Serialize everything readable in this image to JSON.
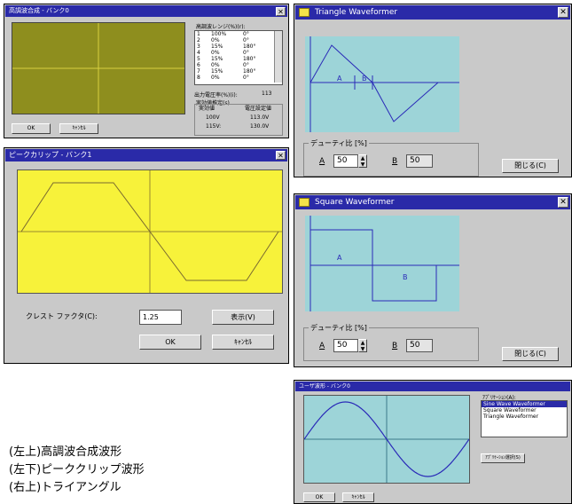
{
  "harmonic": {
    "title": "高調波合成 - バンク0",
    "table_title": "高調波レンジ(%)(r):",
    "rows": [
      {
        "n": "1",
        "pct": "100%",
        "deg": "0°"
      },
      {
        "n": "2",
        "pct": "0%",
        "deg": "0°"
      },
      {
        "n": "3",
        "pct": "15%",
        "deg": "180°"
      },
      {
        "n": "4",
        "pct": "0%",
        "deg": "0°"
      },
      {
        "n": "5",
        "pct": "15%",
        "deg": "180°"
      },
      {
        "n": "6",
        "pct": "0%",
        "deg": "0°"
      },
      {
        "n": "7",
        "pct": "15%",
        "deg": "180°"
      },
      {
        "n": "8",
        "pct": "0%",
        "deg": "0°"
      }
    ],
    "output_label": "出力電圧率(%)(i):",
    "output_value": "113",
    "info_label": "実効値推定(s)",
    "col_actual": "実効値",
    "col_volt": "電圧設定値",
    "actual_1": "100V",
    "volt_1": "113.0V",
    "actual_2": "115V:",
    "volt_2": "130.0V",
    "ok": "OK",
    "cancel": "ｷｬﾝｾﾙ"
  },
  "peak": {
    "title": "ピークカリップ - バンク1",
    "crest_label": "クレスト ファクタ(C):",
    "crest_value": "1.25",
    "display_button": "表示(V)",
    "ok": "OK",
    "cancel": "ｷｬﾝｾﾙ"
  },
  "triangle": {
    "title": "Triangle Waveformer",
    "duty_label": "デューティ比 [%]",
    "a_label": "A",
    "a_value": "50",
    "b_label": "B",
    "b_value": "50",
    "marker_a": "A",
    "marker_b": "B",
    "close_button": "閉じる(C)"
  },
  "square": {
    "title": "Square Waveformer",
    "duty_label": "デューティ比 [%]",
    "a_label": "A",
    "a_value": "50",
    "b_label": "B",
    "b_value": "50",
    "marker_a": "A",
    "marker_b": "B",
    "close_button": "閉じる(C)"
  },
  "memory": {
    "title": "ユーザ波形 - バンク0",
    "list_label": "ｱﾌﾟﾘｹｰｼｮﾝ(A):",
    "items": [
      "Sine Wave Waveformer",
      "Square Waveformer",
      "Triangle Waveformer"
    ],
    "select_button": "ｱﾌﾟﾘｹｰｼｮﾝ選択(S)",
    "ok": "OK",
    "cancel": "ｷｬﾝｾﾙ"
  },
  "captions": [
    "(左上)高調波合成波形",
    "(左下)ピーククリップ波形",
    "(右上)トライアングル"
  ],
  "colors": {
    "titlebar": "#2a2aa8",
    "scope_olive": "#8e8e1e",
    "scope_yellow": "#f7f23a",
    "scope_cyan": "#9dd4d8",
    "trace_blue": "#2a2ab8"
  }
}
